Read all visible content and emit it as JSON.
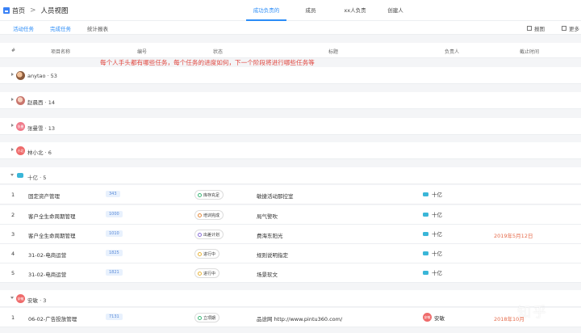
{
  "header": {
    "home": "首页",
    "current": "人员视图",
    "tabs": [
      {
        "label": "成功负责的",
        "active": true
      },
      {
        "label": "成员",
        "active": false
      },
      {
        "label": "xx人负责",
        "active": false
      },
      {
        "label": "创建人",
        "active": false
      }
    ]
  },
  "subnav": {
    "tabs": [
      "活动任务",
      "完成任务",
      "统计报表"
    ],
    "right": [
      "报图",
      "更多"
    ]
  },
  "columns": {
    "index": "#",
    "project": "项目名称",
    "code": "编号",
    "status": "状态",
    "title": "标题",
    "owner": "负责人",
    "deadline": "截止时间"
  },
  "note": "每个人手头都有哪些任务，每个任务的进度如何，下一个阶段将进行哪些任务等",
  "groups": [
    {
      "name": "anytao · 53",
      "avatar": ""
    },
    {
      "name": "赵晨西 · 14",
      "avatar": ""
    },
    {
      "name": "张曼雪 · 13",
      "avatar": "张曼"
    },
    {
      "name": "林小北 · 6",
      "avatar": "小北"
    },
    {
      "name": "十亿 · 5",
      "avatar": ""
    },
    {
      "name": "安敏 · 3",
      "avatar": "安敏"
    }
  ],
  "rows": [
    {
      "index": "1",
      "project": "固定资产管理",
      "code": "343",
      "status": "库存充足",
      "title": "敏捷活动那控室",
      "owner": "十亿",
      "deadline": ""
    },
    {
      "index": "2",
      "project": "客户全生命周期管理",
      "code": "1000",
      "status": "培训完成",
      "title": "局气警吹",
      "owner": "十亿",
      "deadline": ""
    },
    {
      "index": "3",
      "project": "客户全生命周期管理",
      "code": "1010",
      "status": "出差计划",
      "title": "费海东阳光",
      "owner": "十亿",
      "deadline": "2019年5月12日"
    },
    {
      "index": "4",
      "project": "31-02-电商运营",
      "code": "1825",
      "status": "进行中",
      "title": "规则说明指定",
      "owner": "十亿",
      "deadline": ""
    },
    {
      "index": "5",
      "project": "31-02-电商运营",
      "code": "1821",
      "status": "进行中",
      "title": "场景软文",
      "owner": "十亿",
      "deadline": ""
    },
    {
      "index": "1",
      "project": "06-02-广告投放管理",
      "code": "7131",
      "status": "立项期",
      "title": "品途网 http://www.pintu360.com/",
      "owner": "安敏",
      "deadline": "2018年10月"
    }
  ],
  "colors": {
    "accent": "#2b8cf7",
    "note": "#e0443c",
    "deadline": "#e56a4a"
  },
  "watermark": "知乎"
}
